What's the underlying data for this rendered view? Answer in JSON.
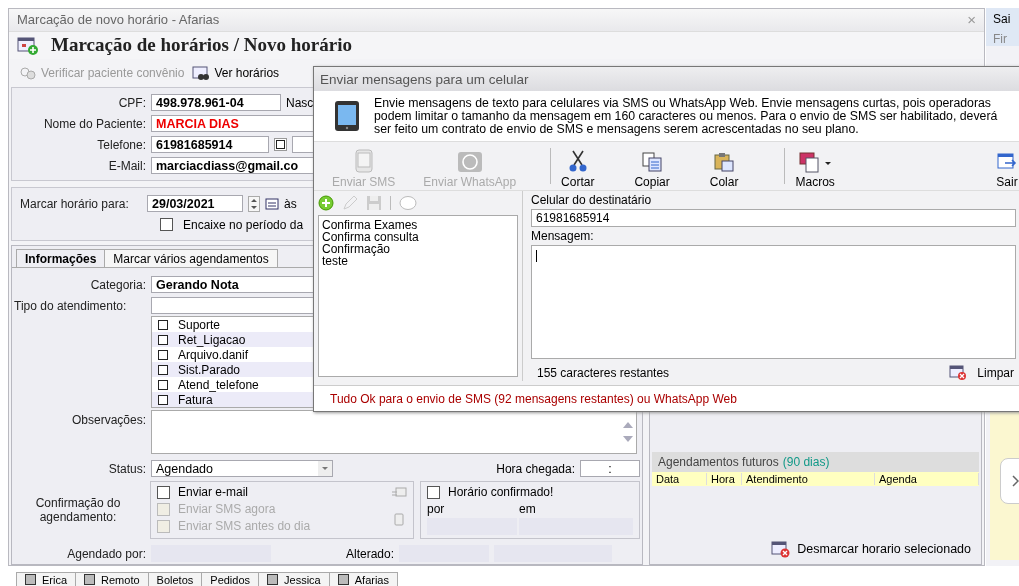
{
  "main_window": {
    "title": "Marcação de novo horário - Afarias",
    "close": "×"
  },
  "header": {
    "title": "Marcação de horários / Novo horário"
  },
  "toolbar": [
    {
      "label": "Verificar paciente convênio",
      "disabled": true
    },
    {
      "label": "Ver horários",
      "disabled": false
    }
  ],
  "patient": {
    "cpf_label": "CPF:",
    "cpf": "498.978.961-04",
    "birth_label": "Nasc",
    "name_label": "Nome do Paciente:",
    "name": "MARCIA DIAS",
    "phone_label": "Telefone:",
    "phone": "61981685914",
    "email_label": "E-Mail:",
    "email": "marciacdiass@gmail.co"
  },
  "schedule": {
    "label": "Marcar horário para:",
    "date": "29/03/2021",
    "at": "às",
    "fit_in": {
      "label": "Encaixe no período da",
      "checked": false
    }
  },
  "tabs": [
    {
      "label": "Informações",
      "selected": true
    },
    {
      "label": "Marcar vários agendamentos",
      "selected": false
    }
  ],
  "info": {
    "category_label": "Categoria:",
    "category": "Gerando Nota",
    "type_label": "Tipo do atendimento:",
    "types": [
      {
        "label": "Suporte",
        "checked": false
      },
      {
        "label": "Ret_Ligacao",
        "checked": false
      },
      {
        "label": "Arquivo.danif",
        "checked": false
      },
      {
        "label": "Sist.Parado",
        "checked": false
      },
      {
        "label": "Atend_telefone",
        "checked": false
      },
      {
        "label": "Fatura",
        "checked": false
      }
    ],
    "notes_label": "Observações:",
    "status_label": "Status:",
    "status": "Agendado",
    "arrival_label": "Hora chegada:",
    "arrival": ":",
    "confirmation_label": "Confirmação do agendamento:",
    "confirmation": [
      {
        "label": "Enviar e-mail",
        "checked": false,
        "disabled": false
      },
      {
        "label": "Enviar SMS agora",
        "checked": false,
        "disabled": true
      },
      {
        "label": "Enviar SMS antes do dia",
        "checked": false,
        "disabled": true
      }
    ],
    "confirmed": {
      "label": "Horário confirmado!",
      "checked": false,
      "by_label": "por",
      "on_label": "em"
    },
    "scheduled_by_label": "Agendado por:",
    "changed_label": "Alterado:"
  },
  "future": {
    "title": "Agendamentos futuros",
    "period": "(90 dias)",
    "columns": [
      "Data",
      "Hora",
      "Atendimento",
      "Agenda"
    ],
    "unschedule_button": "Desmarcar horario selecionado"
  },
  "bottom_tabs": [
    {
      "label": "Erica",
      "kind": "checkbox"
    },
    {
      "label": "Remoto",
      "kind": "checkbox"
    },
    {
      "label": "Boletos",
      "kind": "plain"
    },
    {
      "label": "Pedidos",
      "kind": "plain"
    },
    {
      "label": "Jessica",
      "kind": "checkbox"
    },
    {
      "label": "Afarias",
      "kind": "checkbox"
    }
  ],
  "side_window": {
    "tab": "Sai",
    "label": "Fir"
  },
  "dialog": {
    "title": "Enviar mensagens para um celular",
    "info": "Envie mensagens de texto para celulares via SMS ou WhatsApp Web. Envie mensagens curtas, pois operadoras podem limitar o tamanho da mensagem em 160 caracteres ou menos. Para o envio de SMS ser habilitado, deverá ser feito um contrato de envio de SMS e mensagens serem acrescentadas no seu plano.",
    "tools": [
      {
        "label": "Enviar SMS",
        "kind": "sms",
        "disabled": true
      },
      {
        "label": "Enviar WhatsApp",
        "kind": "whatsapp",
        "disabled": true
      },
      {
        "label": "Cortar",
        "kind": "cut",
        "disabled": false
      },
      {
        "label": "Copiar",
        "kind": "copy",
        "disabled": false
      },
      {
        "label": "Colar",
        "kind": "paste",
        "disabled": false
      },
      {
        "label": "Macros",
        "kind": "macros",
        "disabled": false
      },
      {
        "label": "Sair",
        "kind": "exit",
        "disabled": false
      }
    ],
    "templates": [
      "Confirma Exames",
      "Confirma consulta",
      "Confirmação",
      "teste"
    ],
    "recipient_label": "Celular do destinatário",
    "recipient": "61981685914",
    "message_label": "Mensagem:",
    "remaining": "155 caracteres restantes",
    "clear_button": "Limpar",
    "status": "Tudo Ok para o envio de SMS (92 mensagens restantes) ou WhatsApp Web"
  }
}
